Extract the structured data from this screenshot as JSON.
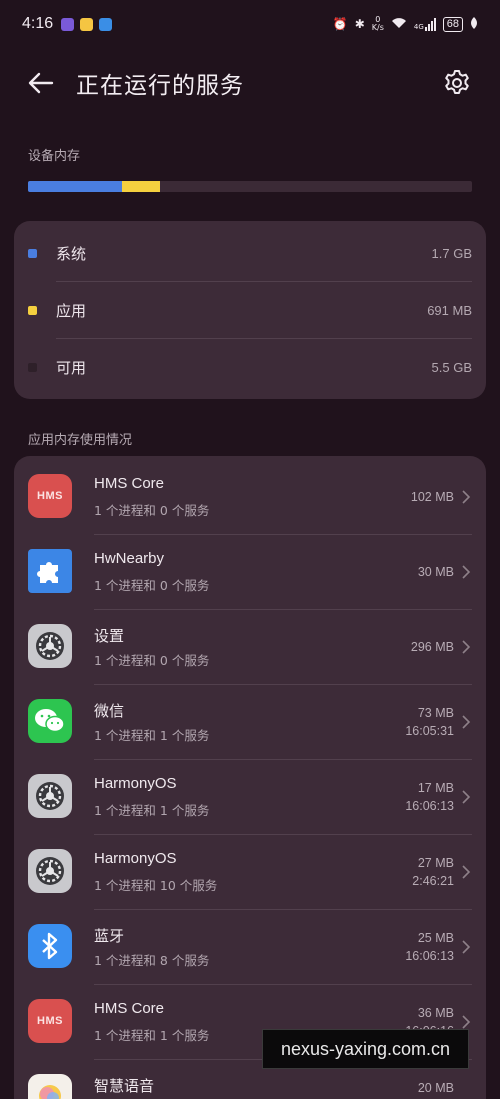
{
  "status_bar": {
    "time": "4:16",
    "net_speed_value": "0",
    "net_speed_unit": "K/s",
    "signal_label": "4G",
    "battery": "68"
  },
  "header": {
    "title": "正在运行的服务"
  },
  "device_memory": {
    "label": "设备内存",
    "usage_fractions": {
      "system": 0.212,
      "apps": 0.085,
      "free": 0.703
    },
    "colors": {
      "system": "#4a7ee0",
      "apps": "#f5d03f",
      "free": "#3b2a36"
    },
    "items": [
      {
        "label": "系统",
        "value": "1.7 GB",
        "color": "#4a7ee0"
      },
      {
        "label": "应用",
        "value": "691 MB",
        "color": "#f5d03f"
      },
      {
        "label": "可用",
        "value": "5.5 GB",
        "color": "#2e2029"
      }
    ]
  },
  "app_memory": {
    "label": "应用内存使用情况",
    "apps": [
      {
        "name": "HMS Core",
        "sub": "1 个进程和 0 个服务",
        "size": "102 MB",
        "time": "",
        "icon": "hms-core-icon"
      },
      {
        "name": "HwNearby",
        "sub": "1 个进程和 0 个服务",
        "size": "30 MB",
        "time": "",
        "icon": "puzzle-icon"
      },
      {
        "name": "设置",
        "sub": "1 个进程和 0 个服务",
        "size": "296 MB",
        "time": "",
        "icon": "settings-gear-icon"
      },
      {
        "name": "微信",
        "sub": "1 个进程和 1 个服务",
        "size": "73 MB",
        "time": "16:05:31",
        "icon": "wechat-icon"
      },
      {
        "name": "HarmonyOS",
        "sub": "1 个进程和 1 个服务",
        "size": "17 MB",
        "time": "16:06:13",
        "icon": "settings-gear-icon"
      },
      {
        "name": "HarmonyOS",
        "sub": "1 个进程和 10 个服务",
        "size": "27 MB",
        "time": "2:46:21",
        "icon": "settings-gear-icon"
      },
      {
        "name": "蓝牙",
        "sub": "1 个进程和 8 个服务",
        "size": "25 MB",
        "time": "16:06:13",
        "icon": "bluetooth-icon"
      },
      {
        "name": "HMS Core",
        "sub": "1 个进程和 1 个服务",
        "size": "36 MB",
        "time": "16:06:16",
        "icon": "hms-core-icon"
      },
      {
        "name": "智慧语音",
        "sub": "",
        "size": "20 MB",
        "time": "",
        "icon": "smart-voice-icon"
      }
    ]
  },
  "watermark": "nexus-yaxing.com.cn"
}
